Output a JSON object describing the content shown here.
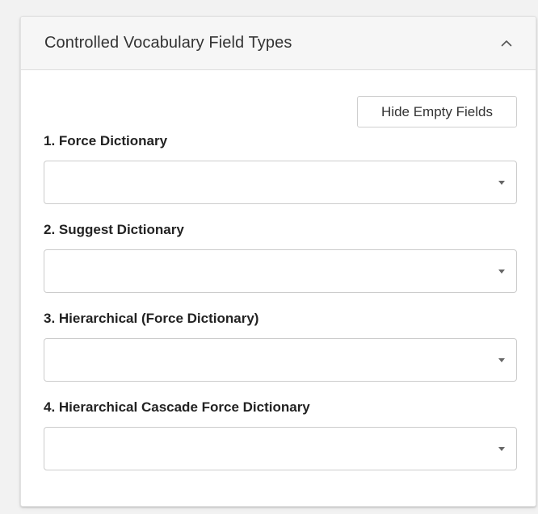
{
  "panel": {
    "title": "Controlled Vocabulary Field Types",
    "toggle_icon": "chevron-up-icon"
  },
  "toolbar": {
    "hide_empty_label": "Hide Empty Fields"
  },
  "fields": [
    {
      "label": "1. Force Dictionary",
      "value": ""
    },
    {
      "label": "2. Suggest Dictionary",
      "value": ""
    },
    {
      "label": "3. Hierarchical (Force Dictionary)",
      "value": ""
    },
    {
      "label": "4. Hierarchical Cascade Force Dictionary",
      "value": ""
    }
  ]
}
